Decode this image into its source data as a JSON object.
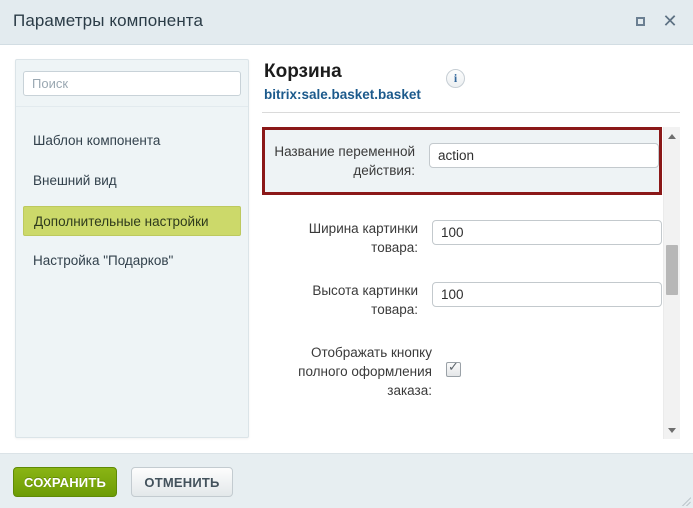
{
  "window": {
    "title": "Параметры компонента",
    "maximize_icon": "maximize-square-icon",
    "close_icon": "close-x-icon"
  },
  "sidebar": {
    "search": {
      "placeholder": "Поиск",
      "value": ""
    },
    "items": [
      {
        "label": "Шаблон компонента",
        "active": false
      },
      {
        "label": "Внешний вид",
        "active": false
      },
      {
        "label": "Дополнительные настройки",
        "active": true
      },
      {
        "label": "Настройка \"Подарков\"",
        "active": false
      }
    ],
    "active_color": "#ccd96a"
  },
  "main": {
    "component_title": "Корзина",
    "component_code": "bitrix:sale.basket.basket",
    "info_icon": "info-circle-icon",
    "info_glyph": "i",
    "highlight_border_color": "#8b1818",
    "fields": [
      {
        "label": "Название переменной действия:",
        "type": "text",
        "value": "action",
        "highlighted": true
      },
      {
        "label": "Ширина картинки товара:",
        "type": "text",
        "value": "100",
        "highlighted": false
      },
      {
        "label": "Высота картинки товара:",
        "type": "text",
        "value": "100",
        "highlighted": false
      },
      {
        "label": "Отображать кнопку полного оформления заказа:",
        "type": "checkbox",
        "checked": true,
        "highlighted": false
      }
    ],
    "scrollbar": {
      "up_arrow_icon": "scroll-up-arrow-icon",
      "down_arrow_icon": "scroll-down-arrow-icon",
      "thumb_position_pct": 38
    }
  },
  "footer": {
    "save_label": "СОХРАНИТЬ",
    "cancel_label": "ОТМЕНИТЬ",
    "save_color": "#7aa80c",
    "resize_grip_icon": "resize-grip-icon"
  }
}
